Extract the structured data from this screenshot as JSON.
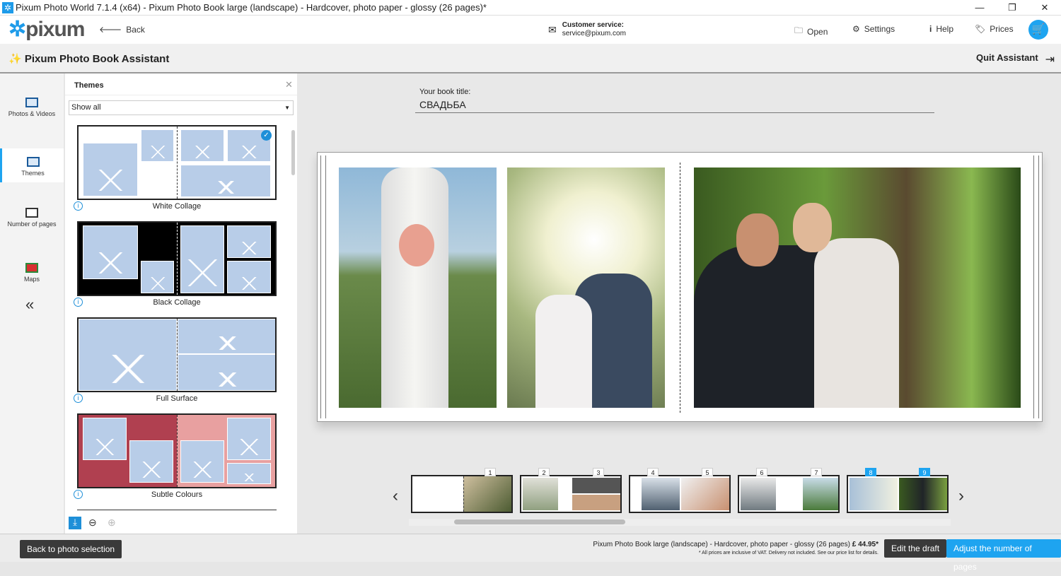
{
  "window": {
    "title": "Pixum Photo World 7.1.4 (x64) - Pixum Photo Book large (landscape) - Hardcover, photo paper - glossy (26 pages)*"
  },
  "header": {
    "logo": "pixum",
    "back": "Back",
    "service_label": "Customer service:",
    "service_email": "service@pixum.com",
    "open": "Open",
    "settings": "Settings",
    "help": "Help",
    "prices": "Prices"
  },
  "assistant": {
    "title": "Pixum Photo Book Assistant",
    "quit": "Quit Assistant"
  },
  "nav": {
    "items": [
      {
        "label": "Photos & Videos"
      },
      {
        "label": "Themes"
      },
      {
        "label": "Number of pages"
      },
      {
        "label": "Maps"
      }
    ],
    "collapse": "«"
  },
  "panel": {
    "title": "Themes",
    "filter": "Show all",
    "themes": [
      {
        "label": "White Collage",
        "selected": true
      },
      {
        "label": "Black Collage"
      },
      {
        "label": "Full Surface"
      },
      {
        "label": "Subtle Colours"
      }
    ]
  },
  "book": {
    "title_label": "Your book title:",
    "title_value": "СВАДЬБА"
  },
  "pages": [
    "1",
    "2",
    "3",
    "4",
    "5",
    "6",
    "7",
    "8",
    "9"
  ],
  "selected_pages": [
    "8",
    "9"
  ],
  "footer": {
    "product": "Pixum Photo Book large (landscape) - Hardcover, photo paper - glossy (26 pages)",
    "price": "£ 44.95*",
    "note": "* All prices are inclusive of VAT. Delivery not included. See our price list for details.",
    "back": "Back to photo selection",
    "edit": "Edit the draft",
    "adjust": "Adjust the number of pages"
  },
  "colors": {
    "accent": "#1ea4f0",
    "dark_button": "#3a3a3a"
  }
}
